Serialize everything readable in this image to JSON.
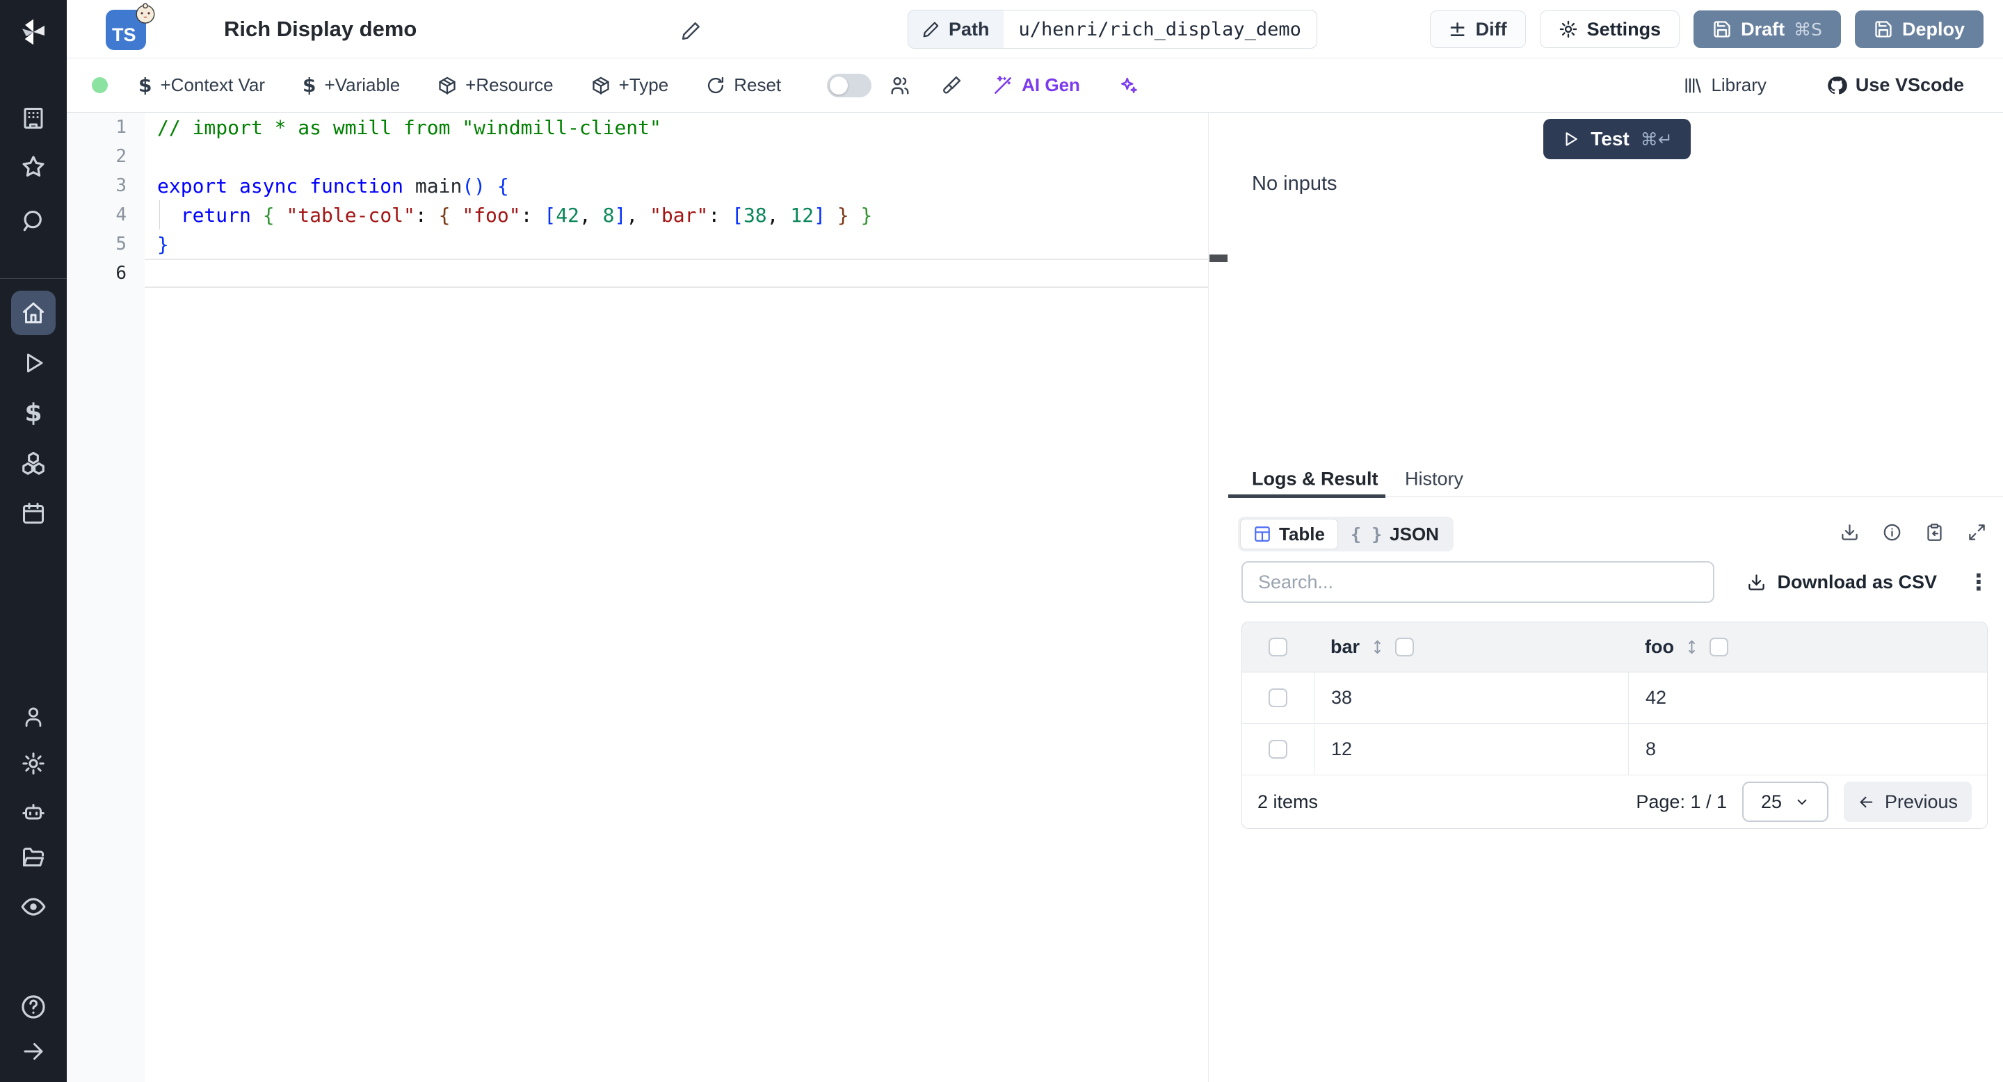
{
  "header": {
    "language_badge": "TS",
    "title": "Rich Display demo",
    "path_label": "Path",
    "path_value": "u/henri/rich_display_demo",
    "diff_label": "Diff",
    "settings_label": "Settings",
    "draft_label": "Draft",
    "draft_shortcut": "⌘S",
    "deploy_label": "Deploy",
    "icons": [
      "typescript-badge",
      "mascot-emoji",
      "pencil-icon",
      "gear-icon",
      "save-icon",
      "plus-minus-icon"
    ]
  },
  "toolbar": {
    "status_color": "#8ce3a1",
    "context_var_label": "+Context Var",
    "variable_label": "+Variable",
    "resource_label": "+Resource",
    "type_label": "+Type",
    "reset_label": "Reset",
    "ai_gen_label": "AI Gen",
    "library_label": "Library",
    "vscode_label": "Use VScode",
    "ai_accent": "#7c3aed",
    "icons": [
      "dollar-icon",
      "dollar-icon",
      "package-icon",
      "package-icon",
      "refresh-icon",
      "toggle-off",
      "users-icon",
      "brush-icon",
      "wand-icon",
      "sparkles-icon",
      "library-icon",
      "github-icon"
    ]
  },
  "sidebar": {
    "background": "#1b1f27",
    "active_item": "home",
    "active_bg": "#46536c",
    "icons": [
      "windmill-logo",
      "workspace-building-icon",
      "favorites-star-icon",
      "search-icon",
      "home-icon",
      "runs-play-icon",
      "variables-dollar-icon",
      "resources-cubes-icon",
      "schedules-calendar-icon",
      "user-icon",
      "settings-gear-icon",
      "workers-robot-icon",
      "folders-icon",
      "audit-eye-icon",
      "help-icon",
      "expand-arrow-icon"
    ]
  },
  "editor": {
    "lines": [
      {
        "num": "1",
        "current": false,
        "tokens": [
          {
            "c": "comment",
            "t": "// import * as wmill from \"windmill-client\""
          }
        ]
      },
      {
        "num": "2",
        "current": false,
        "tokens": []
      },
      {
        "num": "3",
        "current": false,
        "tokens": [
          {
            "c": "kw",
            "t": "export async function"
          },
          {
            "c": "pl",
            "t": " "
          },
          {
            "c": "fn",
            "t": "main"
          },
          {
            "c": "br1",
            "t": "()"
          },
          {
            "c": "pl",
            "t": " "
          },
          {
            "c": "br1",
            "t": "{"
          }
        ]
      },
      {
        "num": "4",
        "current": false,
        "tokens": [
          {
            "c": "pl",
            "t": "  "
          },
          {
            "c": "kw",
            "t": "return"
          },
          {
            "c": "pl",
            "t": " "
          },
          {
            "c": "br2",
            "t": "{"
          },
          {
            "c": "pl",
            "t": " "
          },
          {
            "c": "str",
            "t": "\"table-col\""
          },
          {
            "c": "pl",
            "t": ": "
          },
          {
            "c": "br3",
            "t": "{"
          },
          {
            "c": "pl",
            "t": " "
          },
          {
            "c": "str",
            "t": "\"foo\""
          },
          {
            "c": "pl",
            "t": ": "
          },
          {
            "c": "br1",
            "t": "["
          },
          {
            "c": "num",
            "t": "42"
          },
          {
            "c": "pl",
            "t": ", "
          },
          {
            "c": "num",
            "t": "8"
          },
          {
            "c": "br1",
            "t": "]"
          },
          {
            "c": "pl",
            "t": ", "
          },
          {
            "c": "str",
            "t": "\"bar\""
          },
          {
            "c": "pl",
            "t": ": "
          },
          {
            "c": "br1",
            "t": "["
          },
          {
            "c": "num",
            "t": "38"
          },
          {
            "c": "pl",
            "t": ", "
          },
          {
            "c": "num",
            "t": "12"
          },
          {
            "c": "br1",
            "t": "]"
          },
          {
            "c": "pl",
            "t": " "
          },
          {
            "c": "br3",
            "t": "}"
          },
          {
            "c": "pl",
            "t": " "
          },
          {
            "c": "br2",
            "t": "}"
          }
        ]
      },
      {
        "num": "5",
        "current": false,
        "tokens": [
          {
            "c": "br1",
            "t": "}"
          }
        ]
      },
      {
        "num": "6",
        "current": true,
        "tokens": []
      }
    ]
  },
  "run_panel": {
    "test_label": "Test",
    "test_shortcut": "⌘↵",
    "no_inputs": "No inputs",
    "test_button_color": "#2d3b55"
  },
  "result_panel": {
    "tab_logs": "Logs & Result",
    "tab_history": "History",
    "active_tab": "Logs & Result",
    "view_table_label": "Table",
    "view_json_label": "JSON",
    "view_json_braces": "{ }",
    "active_view": "Table",
    "search_placeholder": "Search...",
    "download_csv_label": "Download as CSV",
    "icons": [
      "table-grid-icon",
      "braces-icon",
      "download-icon",
      "info-icon",
      "clipboard-copy-icon",
      "expand-icon",
      "kebab-menu-icon",
      "sort-icon",
      "chevron-down-icon",
      "arrow-left-icon"
    ],
    "table": {
      "columns": [
        "bar",
        "foo"
      ],
      "rows": [
        {
          "bar": "38",
          "foo": "42"
        },
        {
          "bar": "12",
          "foo": "8"
        }
      ]
    },
    "footer": {
      "items_count": "2 items",
      "page_label": "Page: 1 / 1",
      "page_size": "25",
      "previous_label": "Previous"
    }
  }
}
